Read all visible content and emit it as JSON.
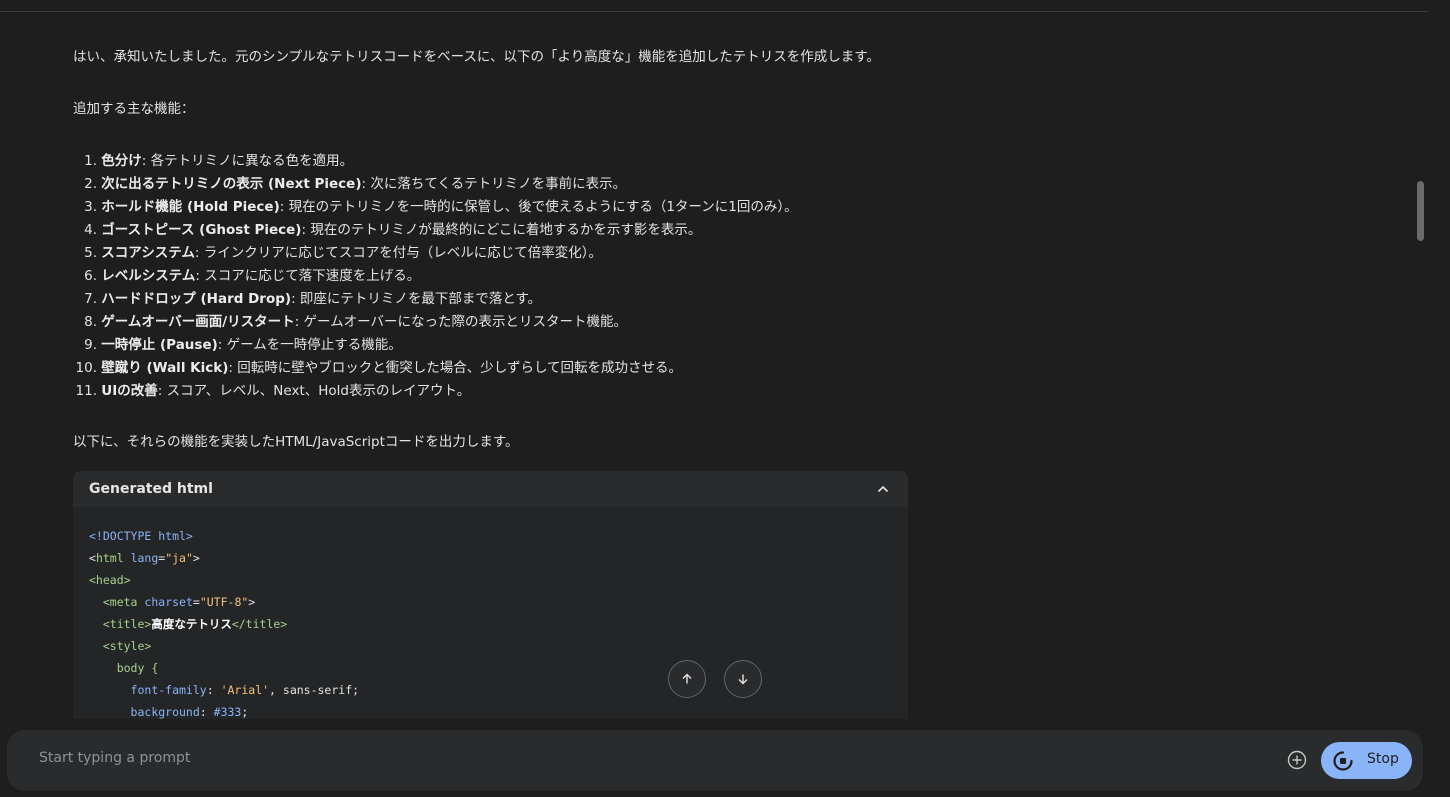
{
  "response": {
    "intro": "はい、承知いたしました。元のシンプルなテトリスコードをベースに、以下の「より高度な」機能を追加したテトリスを作成します。",
    "features_heading": "追加する主な機能：",
    "features": [
      {
        "num": "1.",
        "term": "色分け",
        "desc": ": 各テトリミノに異なる色を適用。"
      },
      {
        "num": "2.",
        "term": "次に出るテトリミノの表示 (Next Piece)",
        "desc": ": 次に落ちてくるテトリミノを事前に表示。"
      },
      {
        "num": "3.",
        "term": "ホールド機能 (Hold Piece)",
        "desc": ": 現在のテトリミノを一時的に保管し、後で使えるようにする（1ターンに1回のみ）。"
      },
      {
        "num": "4.",
        "term": "ゴーストピース (Ghost Piece)",
        "desc": ": 現在のテトリミノが最終的にどこに着地するかを示す影を表示。"
      },
      {
        "num": "5.",
        "term": "スコアシステム",
        "desc": ": ラインクリアに応じてスコアを付与（レベルに応じて倍率変化）。"
      },
      {
        "num": "6.",
        "term": "レベルシステム",
        "desc": ": スコアに応じて落下速度を上げる。"
      },
      {
        "num": "7.",
        "term": "ハードドロップ (Hard Drop)",
        "desc": ": 即座にテトリミノを最下部まで落とす。"
      },
      {
        "num": "8.",
        "term": "ゲームオーバー画面/リスタート",
        "desc": ": ゲームオーバーになった際の表示とリスタート機能。"
      },
      {
        "num": "9.",
        "term": "一時停止 (Pause)",
        "desc": ": ゲームを一時停止する機能。"
      },
      {
        "num": "10.",
        "term": "壁蹴り (Wall Kick)",
        "desc": ": 回転時に壁やブロックと衝突した場合、少しずらして回転を成功させる。"
      },
      {
        "num": "11.",
        "term": "UIの改善",
        "desc": ": スコア、レベル、Next、Hold表示のレイアウト。"
      }
    ],
    "outro": "以下に、それらの機能を実装したHTML/JavaScriptコードを出力します。"
  },
  "code_panel": {
    "title": "Generated html",
    "collapse_icon": "chevron-up-icon",
    "lines": {
      "l1": "<!DOCTYPE html>",
      "l2_open": "<",
      "l2_tag": "html",
      "l2_attr": " lang",
      "l2_eq": "=",
      "l2_val": "\"ja\"",
      "l2_close": ">",
      "l3": "<head>",
      "l4_attr": "charset",
      "l4_val": "\"UTF-8\"",
      "l5_text": "高度なテトリス",
      "l6": "<style>",
      "l7": "body {",
      "l8_prop": "font-family",
      "l8_val": "'Arial'",
      "l8_rest": ", sans-serif;",
      "l9_prop": "background",
      "l9_val": "#333",
      "l9_rest": ";"
    }
  },
  "scroll_controls": {
    "up_icon": "arrow-up-icon",
    "down_icon": "arrow-down-icon"
  },
  "prompt": {
    "placeholder": "Start typing a prompt",
    "add_icon": "add-circle-icon",
    "stop_label": "Stop",
    "stop_icon": "stop-spinner-icon"
  },
  "colors": {
    "background": "#1e1e1f",
    "panel": "#2a2b2d",
    "accent": "#8ab4f8"
  }
}
